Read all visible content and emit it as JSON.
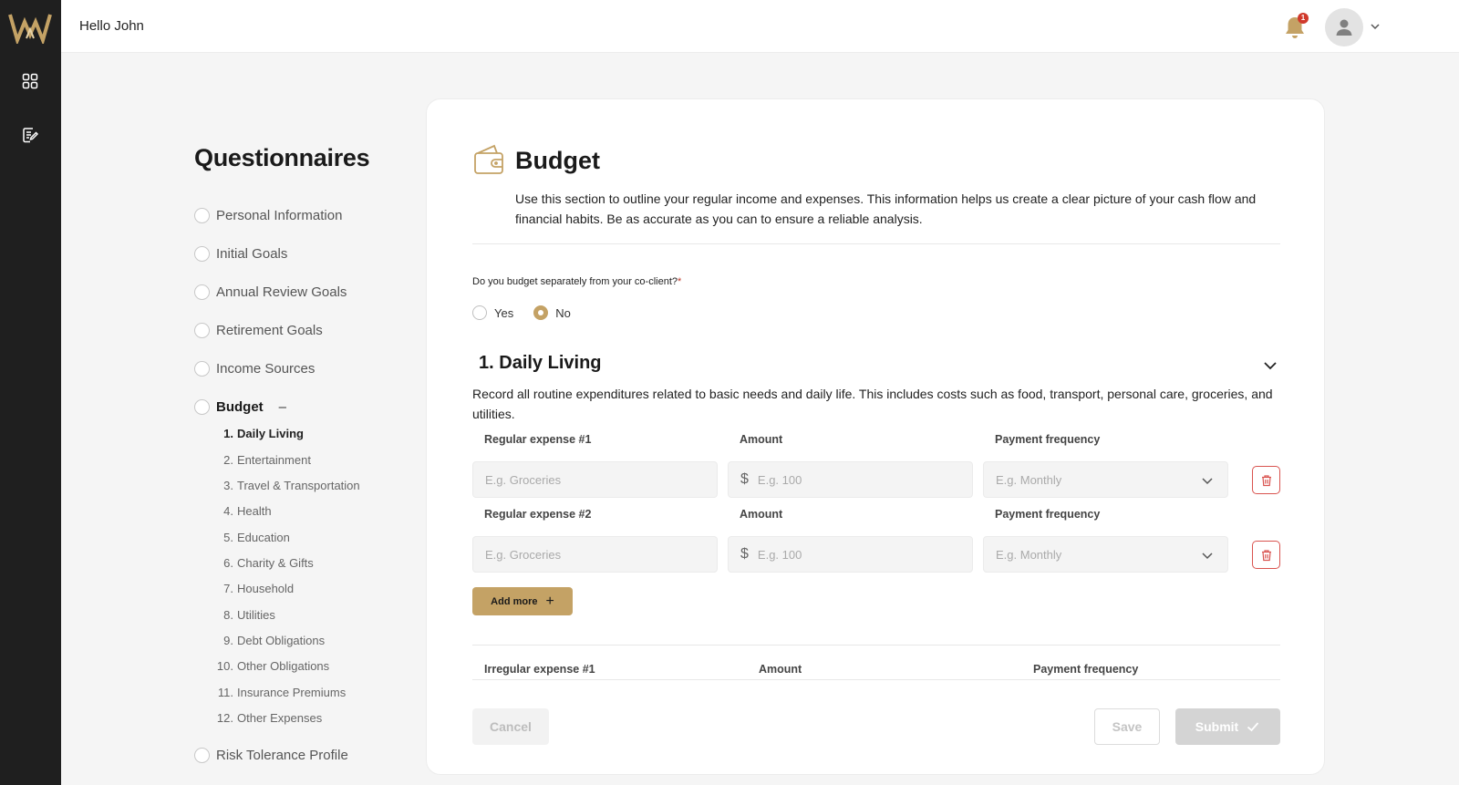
{
  "app": {
    "greeting": "Hello John",
    "notification_count": "1",
    "accent_color": "#c4a265",
    "icons": [
      "brand-logo-icon",
      "dashboard-grid-icon",
      "questionnaire-edit-icon",
      "bell-icon",
      "user-icon",
      "chevron-down-icon",
      "wallet-icon",
      "trash-icon",
      "plus-icon",
      "check-icon",
      "dollar-icon"
    ]
  },
  "sidebar": {
    "title": "Questionnaires",
    "items": [
      {
        "label": "Personal Information"
      },
      {
        "label": "Initial Goals"
      },
      {
        "label": "Annual Review Goals"
      },
      {
        "label": "Retirement Goals"
      },
      {
        "label": "Income Sources"
      },
      {
        "label": "Budget",
        "collapse_symbol": "–"
      },
      {
        "label": "Risk Tolerance Profile"
      }
    ],
    "sub_items": [
      {
        "num": "1.",
        "label": "Daily Living"
      },
      {
        "num": "2.",
        "label": "Entertainment"
      },
      {
        "num": "3.",
        "label": "Travel & Transportation"
      },
      {
        "num": "4.",
        "label": "Health"
      },
      {
        "num": "5.",
        "label": "Education"
      },
      {
        "num": "6.",
        "label": "Charity & Gifts"
      },
      {
        "num": "7.",
        "label": "Household"
      },
      {
        "num": "8.",
        "label": "Utilities"
      },
      {
        "num": "9.",
        "label": "Debt Obligations"
      },
      {
        "num": "10.",
        "label": "Other Obligations"
      },
      {
        "num": "11.",
        "label": "Insurance Premiums"
      },
      {
        "num": "12.",
        "label": "Other Expenses"
      }
    ]
  },
  "card": {
    "title": "Budget",
    "description": "Use this section to outline your regular income and expenses. This information helps us create a clear picture of your cash flow and financial habits. Be as accurate as you can to ensure a reliable analysis.",
    "question": "Do you budget separately from your co-client?",
    "required_mark": "*",
    "options": {
      "yes": "Yes",
      "no": "No",
      "selected": "No"
    },
    "section": {
      "number": "1.",
      "title": "Daily Living",
      "description": "Record all routine expenditures related to basic needs and daily life. This includes costs such as food, transport, personal care, groceries, and utilities."
    },
    "regular_rows": [
      {
        "expense_label": "Regular expense #1",
        "expense_placeholder": "E.g. Groceries",
        "amount_label": "Amount",
        "currency": "$",
        "amount_placeholder": "E.g. 100",
        "frequency_label": "Payment frequency",
        "frequency_placeholder": "E.g. Monthly"
      },
      {
        "expense_label": "Regular expense #2",
        "expense_placeholder": "E.g. Groceries",
        "amount_label": "Amount",
        "currency": "$",
        "amount_placeholder": "E.g. 100",
        "frequency_label": "Payment frequency",
        "frequency_placeholder": "E.g. Monthly"
      }
    ],
    "add_more_label": "Add more",
    "irregular_row": {
      "expense_label": "Irregular expense #1",
      "amount_label": "Amount",
      "frequency_label": "Payment frequency"
    },
    "buttons": {
      "cancel": "Cancel",
      "save": "Save",
      "submit": "Submit"
    }
  }
}
